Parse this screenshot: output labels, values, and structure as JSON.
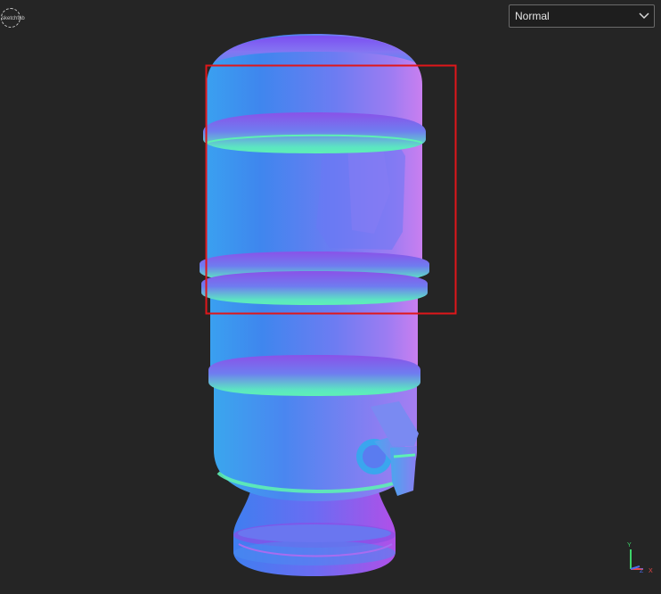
{
  "viewer": {
    "logo_text": "sketchfab",
    "render_mode": {
      "selected": "Normal",
      "icon": "chevron-down-icon"
    },
    "axis_gizmo": {
      "y": "Y",
      "z": "Z",
      "x": "X"
    }
  },
  "colors": {
    "background": "#252525",
    "selection_box": "#e0161a",
    "normal_blue": "#4f7cf0",
    "normal_violet": "#b07cf2",
    "normal_green": "#5ef0b4",
    "axis_y": "#3dd46a",
    "axis_x": "#e84545",
    "axis_z": "#4d6ef0"
  }
}
